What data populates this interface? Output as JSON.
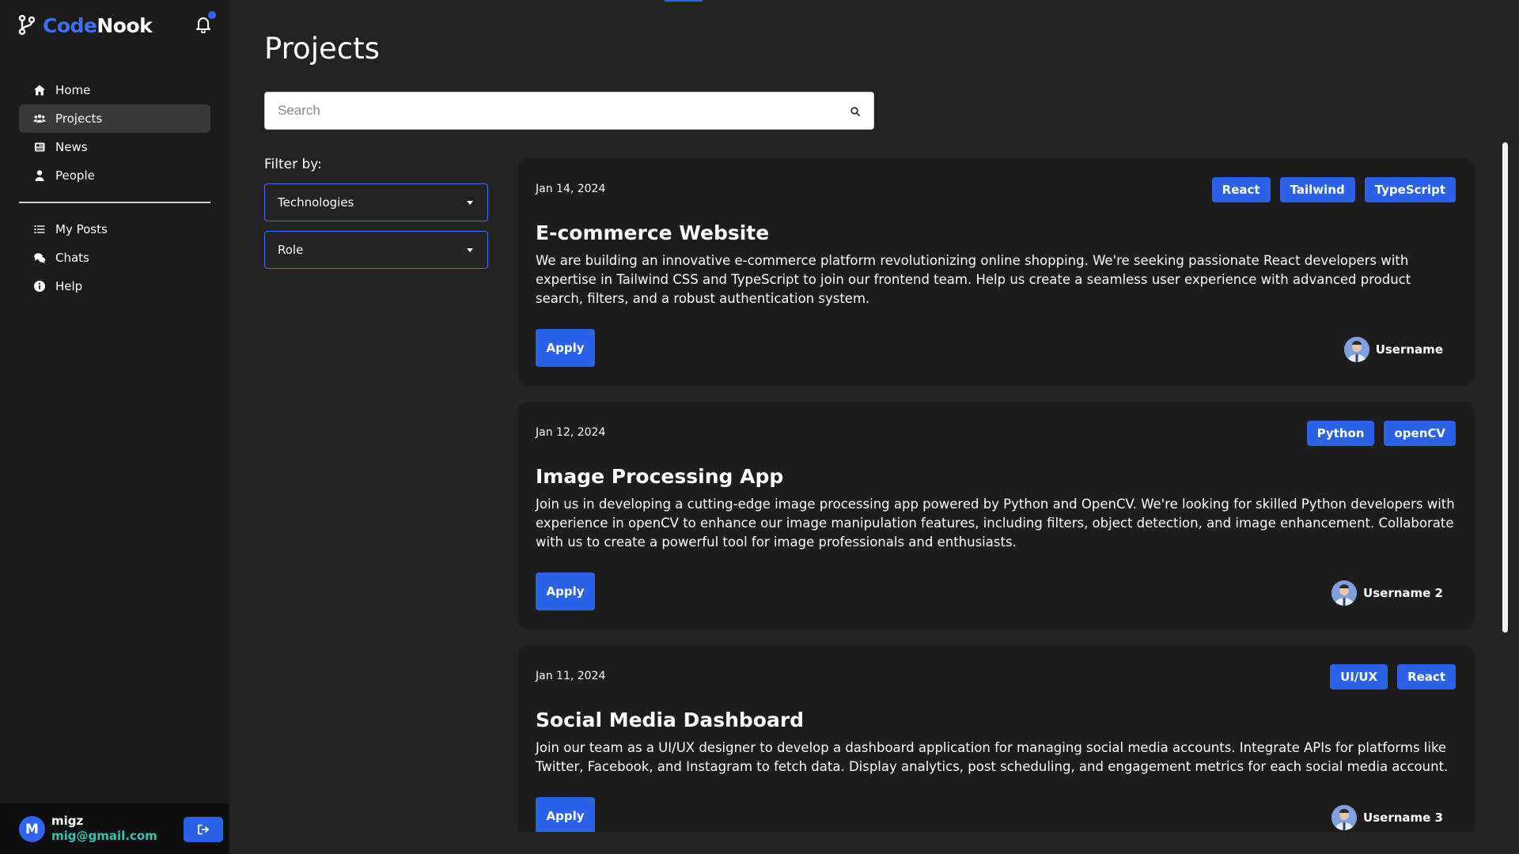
{
  "brand": {
    "code": "Code",
    "nook": "Nook"
  },
  "colors": {
    "accent": "#2a62e8",
    "background": "#232323",
    "sidebar": "#1b1b1b",
    "card": "#1d1d1d",
    "email": "#33c3b3"
  },
  "sidebar": {
    "main_items": [
      {
        "label": "Home",
        "icon": "home-icon"
      },
      {
        "label": "Projects",
        "icon": "users-icon",
        "active": true
      },
      {
        "label": "News",
        "icon": "newspaper-icon"
      },
      {
        "label": "People",
        "icon": "person-icon"
      }
    ],
    "secondary_items": [
      {
        "label": "My Posts",
        "icon": "list-icon"
      },
      {
        "label": "Chats",
        "icon": "chat-icon"
      },
      {
        "label": "Help",
        "icon": "info-icon"
      }
    ]
  },
  "user": {
    "initial": "M",
    "name": "migz",
    "email": "mig@gmail.com"
  },
  "page": {
    "title": "Projects"
  },
  "search": {
    "placeholder": "Search",
    "value": ""
  },
  "filters": {
    "label": "Filter by:",
    "technologies": "Technologies",
    "role": "Role"
  },
  "projects": [
    {
      "date": "Jan 14, 2024",
      "tags": [
        "React",
        "Tailwind",
        "TypeScript"
      ],
      "title": "E-commerce Website",
      "description": "We are building an innovative e-commerce platform revolutionizing online shopping. We're seeking passionate React developers with expertise in Tailwind CSS and TypeScript to join our frontend team. Help us create a seamless user experience with advanced product search, filters, and a robust authentication system.",
      "apply_label": "Apply",
      "author": "Username"
    },
    {
      "date": "Jan 12, 2024",
      "tags": [
        "Python",
        "openCV"
      ],
      "title": "Image Processing App",
      "description": "Join us in developing a cutting-edge image processing app powered by Python and OpenCV. We're looking for skilled Python developers with experience in openCV to enhance our image manipulation features, including filters, object detection, and image enhancement. Collaborate with us to create a powerful tool for image professionals and enthusiasts.",
      "apply_label": "Apply",
      "author": "Username 2"
    },
    {
      "date": "Jan 11, 2024",
      "tags": [
        "UI/UX",
        "React"
      ],
      "title": "Social Media Dashboard",
      "description": "Join our team as a UI/UX designer to develop a dashboard application for managing social media accounts. Integrate APIs for platforms like Twitter, Facebook, and Instagram to fetch data. Display analytics, post scheduling, and engagement metrics for each social media account.",
      "apply_label": "Apply",
      "author": "Username 3"
    }
  ]
}
